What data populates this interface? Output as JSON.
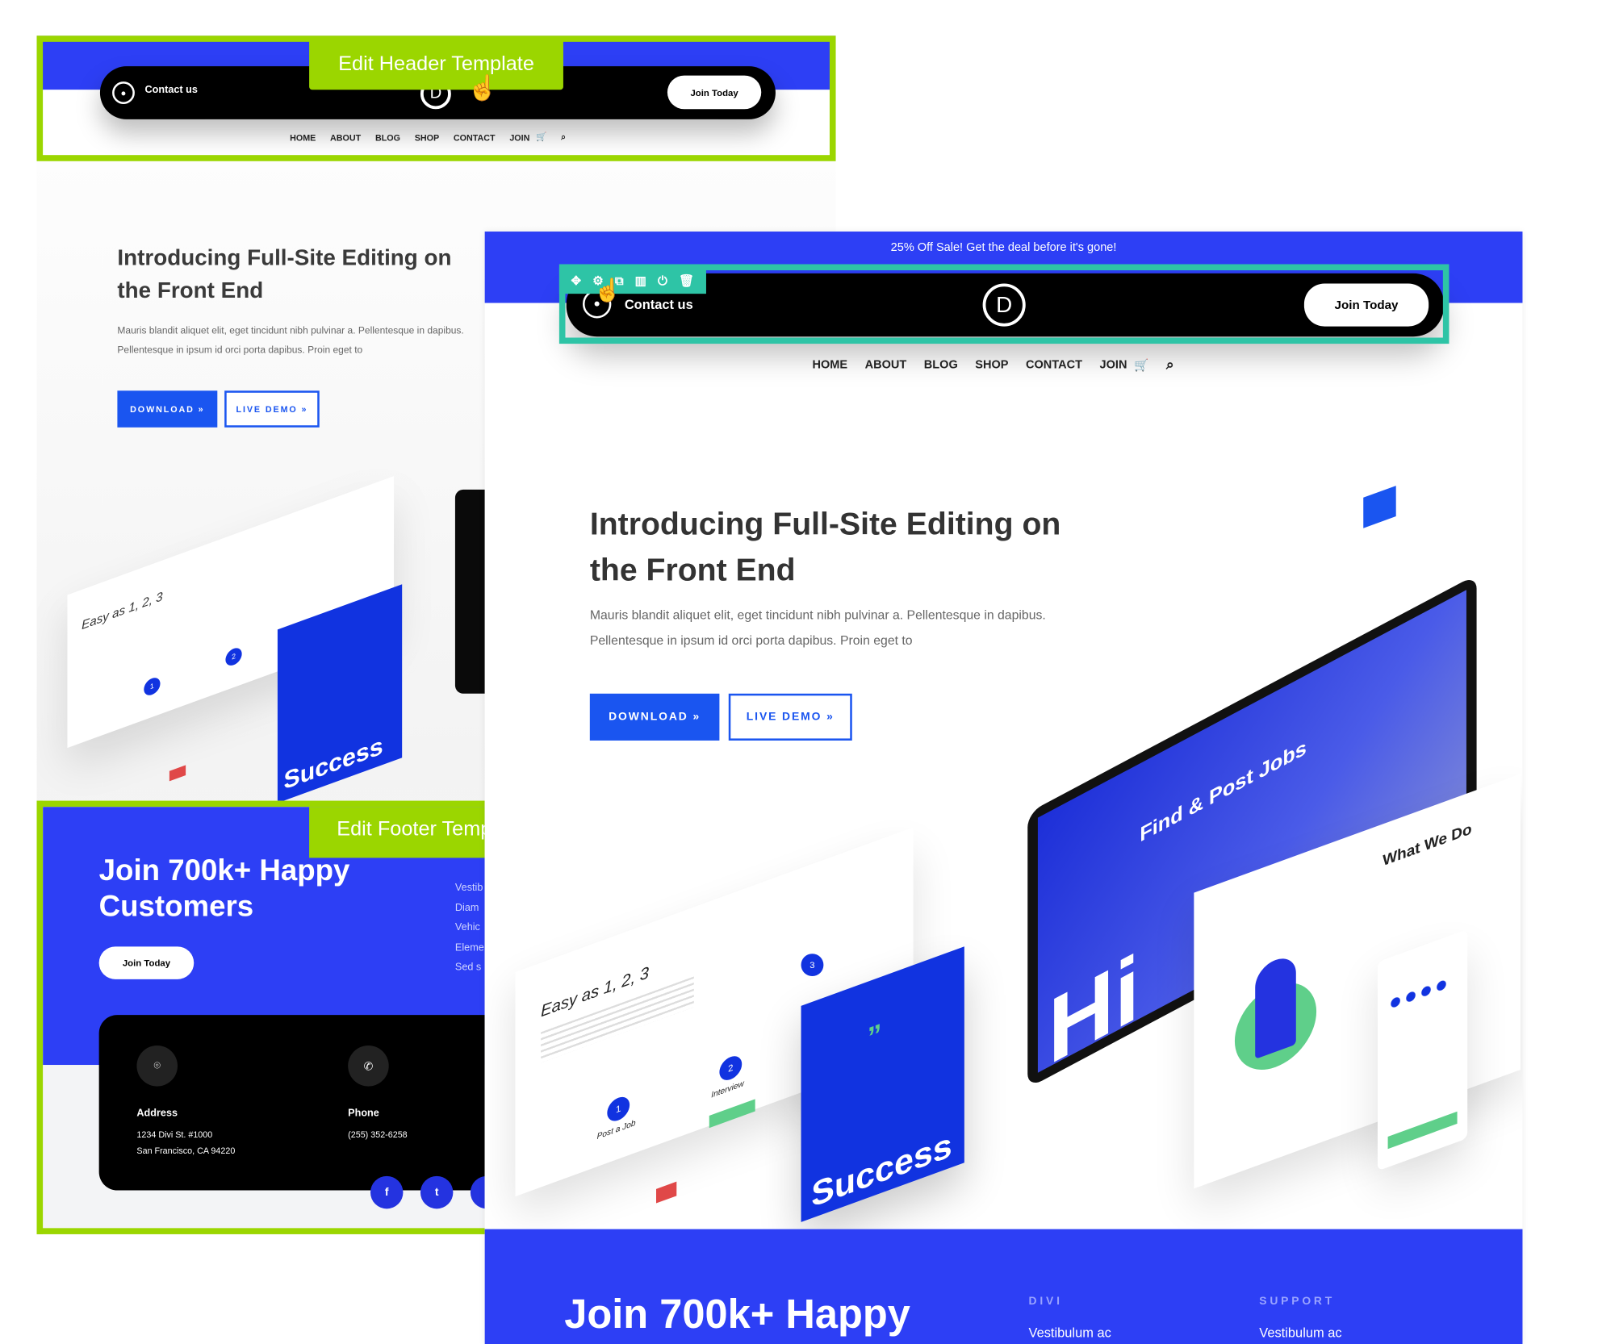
{
  "back_page": {
    "edit_header_label": "Edit Header Template",
    "edit_footer_label": "Edit Footer Template",
    "header": {
      "contact": "Contact us",
      "logo": "D",
      "join": "Join Today"
    },
    "nav": [
      "HOME",
      "ABOUT",
      "BLOG",
      "SHOP",
      "CONTACT",
      "JOIN"
    ],
    "hero": {
      "title_line1": "Introducing Full-Site Editing on",
      "title_line2": "the Front End",
      "para_line1": "Mauris blandit aliquet elit, eget tincidunt nibh pulvinar a. Pellentesque in dapibus.",
      "para_line2": "Pellentesque in ipsum id orci porta dapibus. Proin eget to",
      "download": "DOWNLOAD »",
      "live_demo": "LIVE DEMO »"
    },
    "illustration": {
      "easy": "Easy as 1, 2, 3",
      "step1": "Post a Job",
      "step2": "Interview",
      "success": "Success"
    },
    "footer": {
      "title_line1": "Join 700k+ Happy",
      "title_line2": "Customers",
      "join": "Join Today",
      "links": [
        "Vestib",
        "Diam",
        "Vehic",
        "Eleme",
        "Sed s"
      ],
      "address_label": "Address",
      "address_line1": "1234 Divi St. #1000",
      "address_line2": "San Francisco, CA 94220",
      "phone_label": "Phone",
      "phone": "(255) 352-6258",
      "social": [
        "f",
        "t"
      ]
    }
  },
  "front_page": {
    "sale_banner": "25% Off Sale! Get the deal before it's gone!",
    "header": {
      "contact": "Contact us",
      "logo": "D",
      "join": "Join Today"
    },
    "toolbar_icons": [
      "move-icon",
      "gear-icon",
      "duplicate-icon",
      "columns-icon",
      "power-icon",
      "trash-icon"
    ],
    "nav": [
      "HOME",
      "ABOUT",
      "BLOG",
      "SHOP",
      "CONTACT",
      "JOIN"
    ],
    "hero": {
      "title_line1": "Introducing Full-Site Editing on",
      "title_line2": "the Front End",
      "para_line1": "Mauris blandit aliquet elit, eget tincidunt nibh pulvinar a. Pellentesque in dapibus.",
      "para_line2": "Pellentesque in ipsum id orci porta dapibus. Proin eget to",
      "download": "DOWNLOAD »",
      "live_demo": "LIVE DEMO »"
    },
    "illustration": {
      "easy": "Easy as 1, 2, 3",
      "step1": "Post a Job",
      "step2": "Interview",
      "step3": "3",
      "success": "Success",
      "find_jobs": "Find & Post Jobs",
      "what_we_do": "What We Do",
      "hire": "Hi"
    },
    "footer": {
      "title": "Join 700k+ Happy",
      "col1_heading": "DIVI",
      "col1_link": "Vestibulum ac",
      "col2_heading": "SUPPORT",
      "col2_link": "Vestibulum ac"
    }
  },
  "colors": {
    "edit_green": "#9bd600",
    "toolbar_teal": "#2ec4a6",
    "brand_blue": "#2d3ff5",
    "button_blue": "#1a55f0"
  }
}
